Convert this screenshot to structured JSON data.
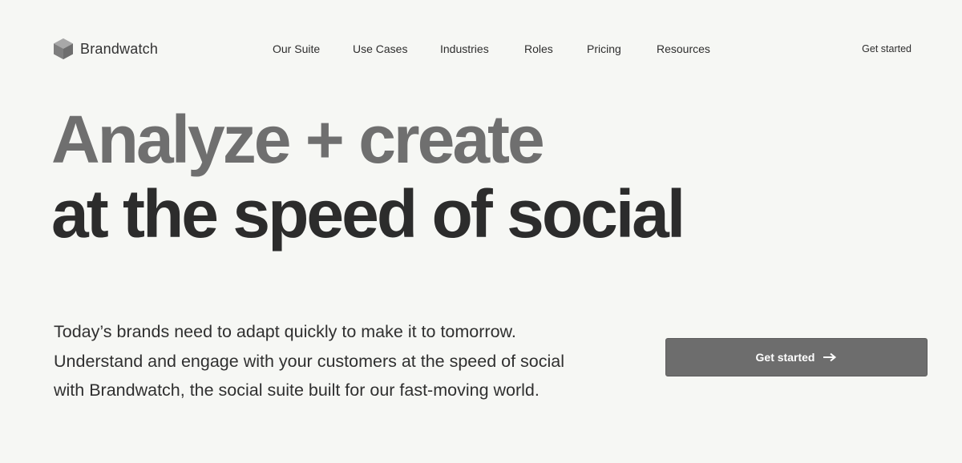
{
  "brand": {
    "name": "Brandwatch",
    "logo_icon": "hexagon-cube-icon"
  },
  "nav": {
    "items": [
      {
        "label": "Our Suite"
      },
      {
        "label": "Use Cases"
      },
      {
        "label": "Industries"
      },
      {
        "label": "Roles"
      },
      {
        "label": "Pricing"
      },
      {
        "label": "Resources"
      }
    ],
    "cta_label": "Get started"
  },
  "hero": {
    "headline_line1": "Analyze + create",
    "headline_line2": "at the speed of social",
    "description_lines": [
      "Today’s brands need to adapt quickly to make it to tomorrow.",
      "Understand and engage with your customers at the speed of social",
      "with Brandwatch, the social suite built for our fast-moving world."
    ],
    "cta_label": "Get started",
    "cta_icon": "arrow-right-icon"
  },
  "colors": {
    "background": "#f6f7f4",
    "text": "#2b2b2b",
    "headline_accent": "#6f6f6f",
    "button": "#6d6d6d"
  }
}
